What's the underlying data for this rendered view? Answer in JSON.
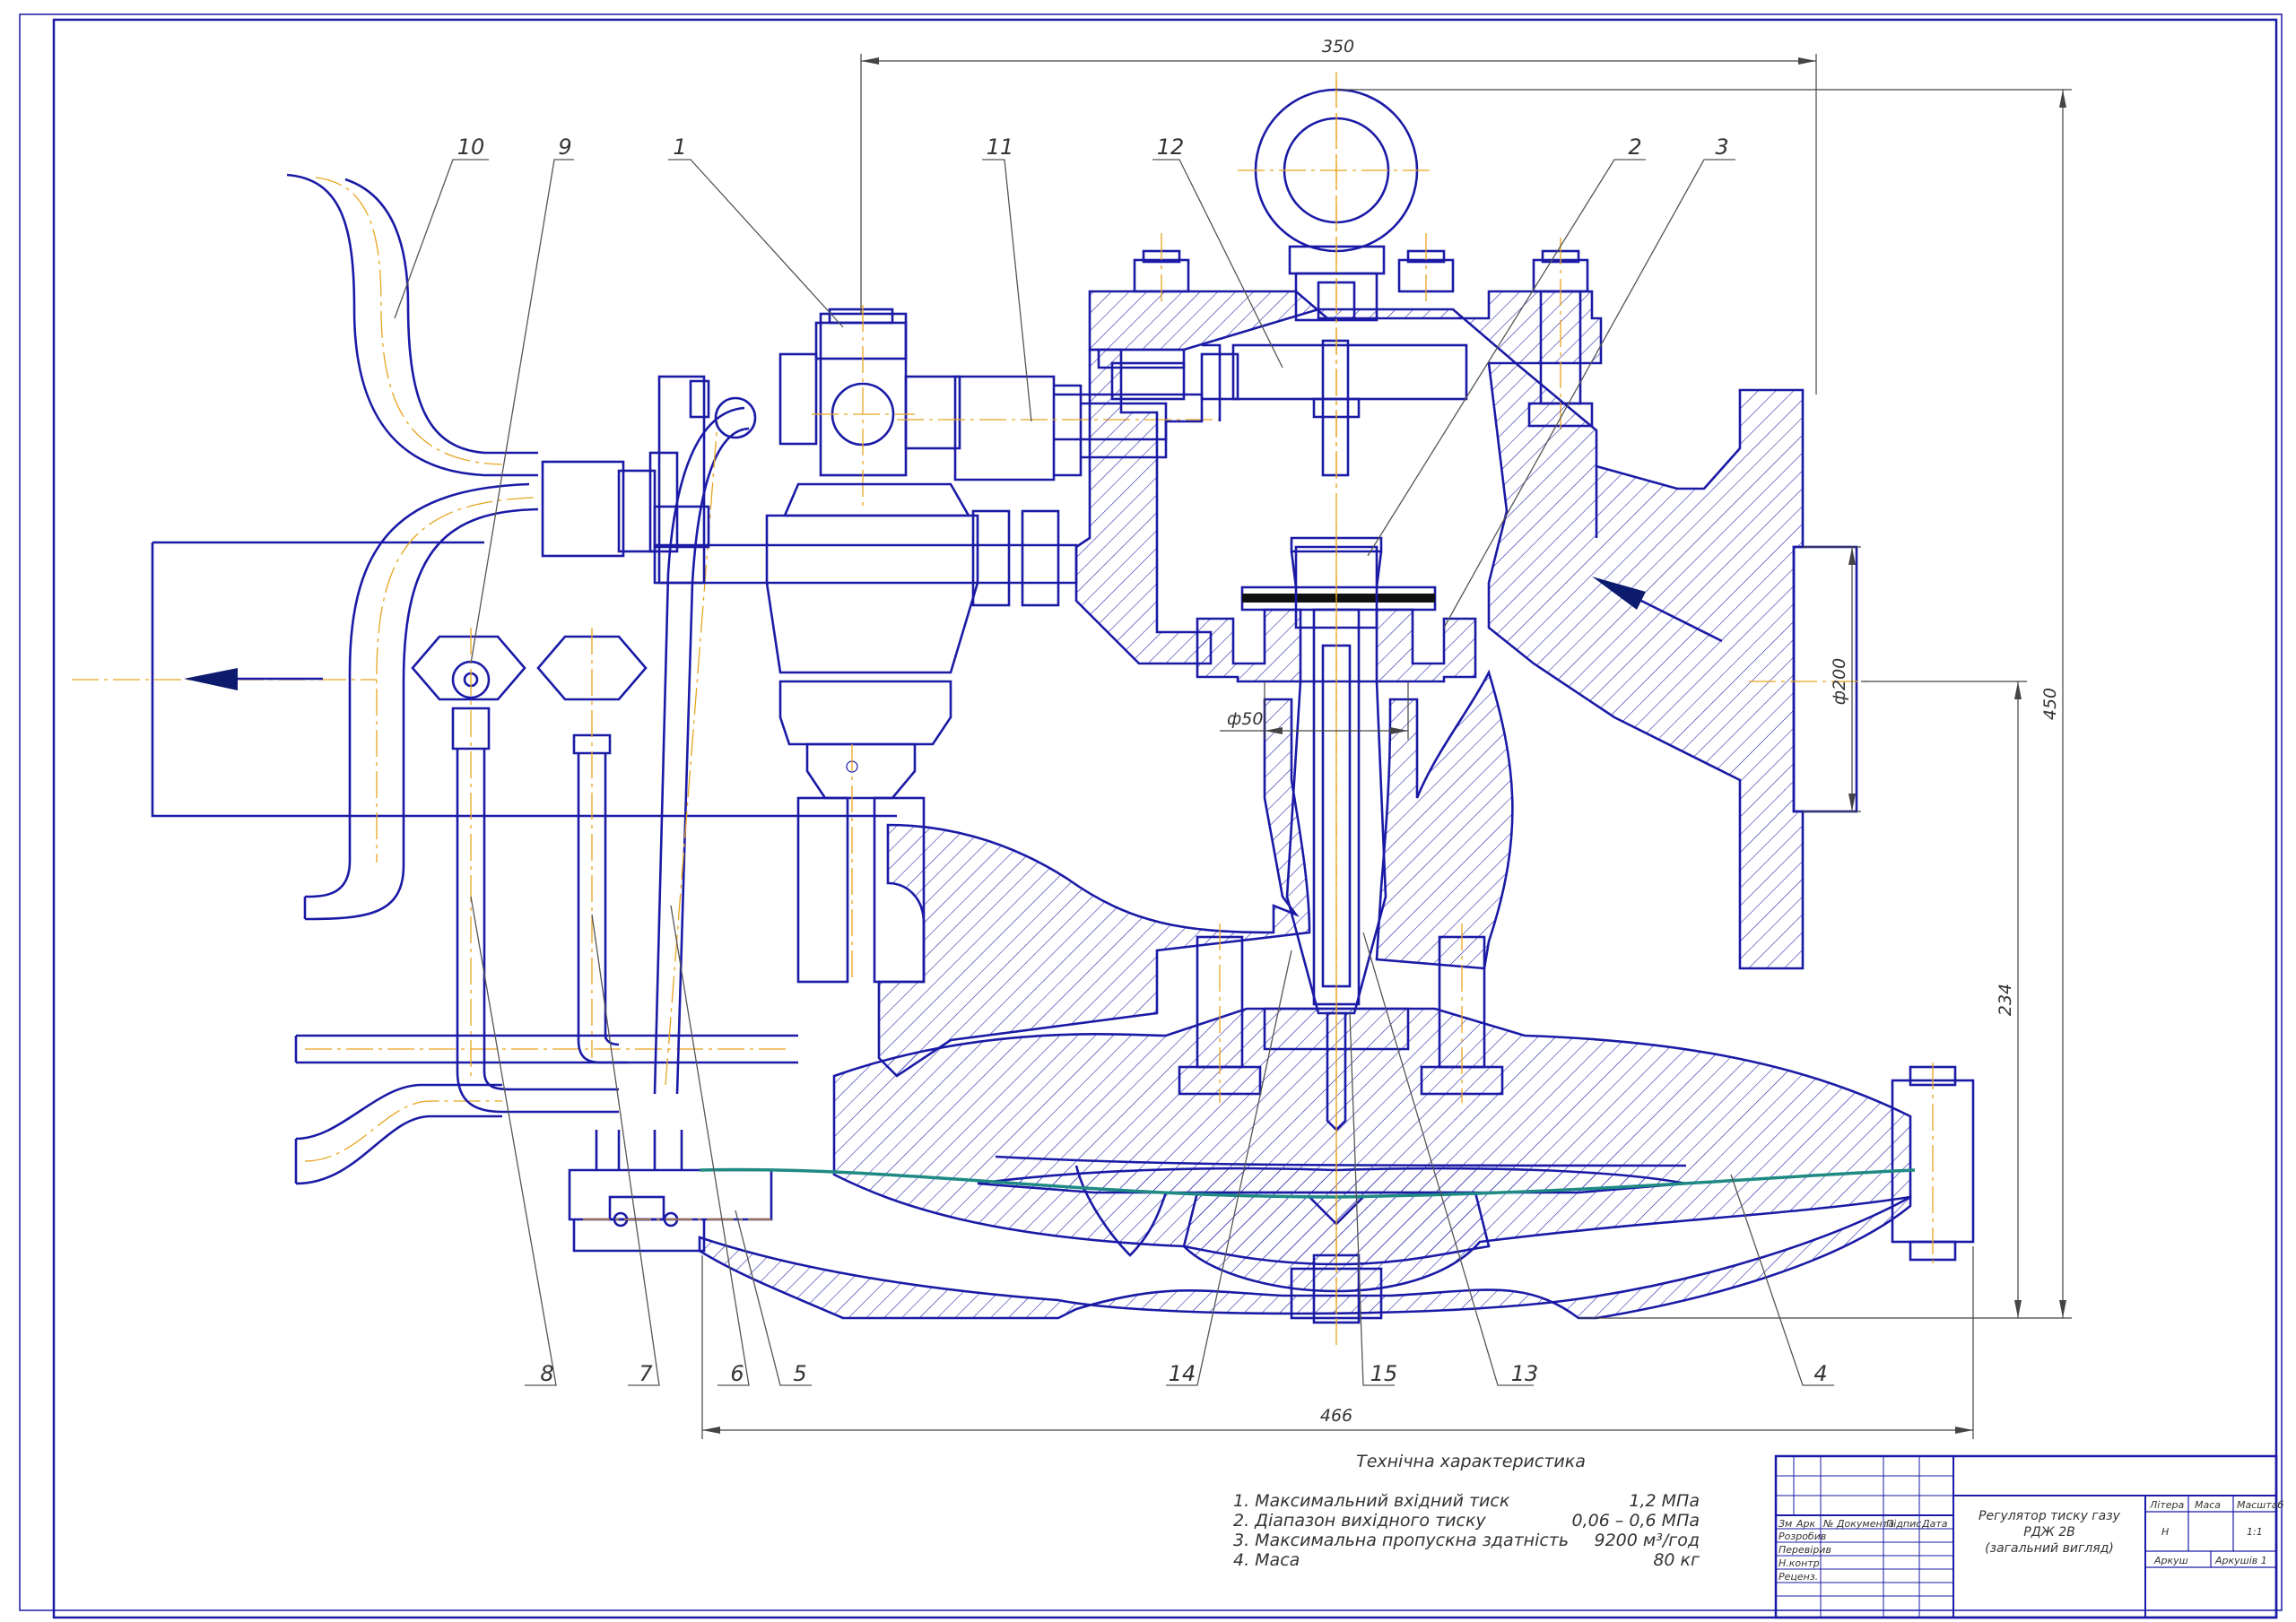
{
  "drawing": {
    "part_numbers": [
      "1",
      "2",
      "3",
      "4",
      "5",
      "6",
      "7",
      "8",
      "9",
      "10",
      "11",
      "12",
      "13",
      "14",
      "15"
    ],
    "dimensions": {
      "top_width": "350",
      "overall_height": "450",
      "body_height": "234",
      "outlet_diameter": "ф200",
      "seat_diameter": "ф50",
      "bottom_width": "466"
    },
    "colors": {
      "outline": "#1a1aa6",
      "center": "#e7a41e",
      "membrane": "#1f8a84"
    }
  },
  "spec": {
    "title": "Технічна характеристика",
    "items": [
      {
        "label": "1. Максимальний вхідний тиск",
        "value": "1,2 МПа"
      },
      {
        "label": "2. Діапазон вихідного тиску",
        "value": "0,06 – 0,6 МПа"
      },
      {
        "label": "3. Максимальна пропускна здатність",
        "value": "9200 м³/год"
      },
      {
        "label": "4. Маса",
        "value": "80 кг"
      }
    ]
  },
  "stamp": {
    "title_line1": "Регулятор тиску газу",
    "title_line2": "РДЖ 2В",
    "title_line3": "(загальний вигляд)",
    "header_cells": [
      "Зм",
      "Арк",
      "№ Документа",
      "Підпис",
      "Дата"
    ],
    "rows": [
      "Розробив",
      "Перевірив",
      "Н.контр",
      "Реценз."
    ],
    "litera": "Літера",
    "mass": "Маса",
    "scale": "Масштаб",
    "litera_value": "Н",
    "scale_value": "1:1",
    "sheet": "Аркуш",
    "sheets": "Аркушів 1"
  }
}
